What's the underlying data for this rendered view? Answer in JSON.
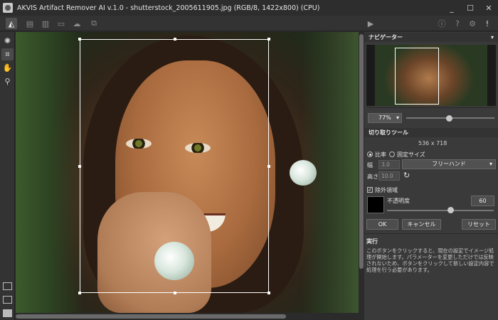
{
  "window": {
    "title": "AKVIS Artifact Remover AI v.1.0 - shutterstock_2005611905.jpg (RGB/8, 1422x800) (CPU)",
    "controls": [
      "_",
      "☐",
      "✕"
    ]
  },
  "toolbar": {
    "icons": [
      "mode-icon",
      "open-icon",
      "save-icon",
      "print-icon",
      "share-icon",
      "batch-icon"
    ],
    "right_icons": [
      "run-icon",
      "info-icon",
      "help-icon",
      "settings-icon",
      "alert-icon"
    ]
  },
  "tools": [
    "remove-icon",
    "crop-icon",
    "hand-icon",
    "zoom-icon"
  ],
  "navigator": {
    "title": "ナビゲーター",
    "zoom_value": "77%"
  },
  "crop_tool": {
    "title": "切り取りツール",
    "size_readout": "536 x 718",
    "ratio_label": "比率",
    "fixed_size_label": "固定サイズ",
    "width_label": "幅",
    "width_value": "3.0",
    "height_label": "高さ",
    "height_value": "10.0",
    "ratio_select": "フリーハンド",
    "exclude_label": "除外領域",
    "opacity_label": "不透明度",
    "opacity_value": "60",
    "ok_button": "OK",
    "cancel_button": "キャンセル",
    "reset_button": "リセット"
  },
  "info": {
    "title": "実行",
    "text": "このボタンをクリックすると、現在の設定でイメージ処理が開始します。パラメーターを変更しただけでは反映されないため、ボタンをクリックして新しい設定内容で処理を行う必要があります。"
  },
  "colors": {
    "panel": "#3a3a3a",
    "background": "#2b2b2b",
    "accent": "#ffffff"
  }
}
